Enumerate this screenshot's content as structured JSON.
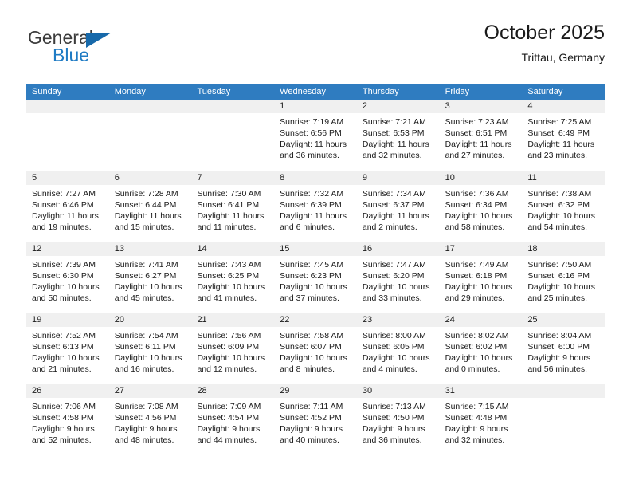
{
  "brand": {
    "name_top": "General",
    "name_bottom": "Blue",
    "accent_color": "#1f7bc4",
    "triangle_color": "#1769aa"
  },
  "header": {
    "title": "October 2025",
    "location": "Trittau, Germany"
  },
  "theme": {
    "header_bg": "#2f7cc0",
    "day_band_bg": "#f0f0f0",
    "cell_bg": "#ffffff",
    "text_color": "#1a1a1a"
  },
  "weekdays": [
    "Sunday",
    "Monday",
    "Tuesday",
    "Wednesday",
    "Thursday",
    "Friday",
    "Saturday"
  ],
  "weeks": [
    [
      {
        "day": "",
        "lines": []
      },
      {
        "day": "",
        "lines": []
      },
      {
        "day": "",
        "lines": []
      },
      {
        "day": "1",
        "lines": [
          "Sunrise: 7:19 AM",
          "Sunset: 6:56 PM",
          "Daylight: 11 hours",
          "and 36 minutes."
        ]
      },
      {
        "day": "2",
        "lines": [
          "Sunrise: 7:21 AM",
          "Sunset: 6:53 PM",
          "Daylight: 11 hours",
          "and 32 minutes."
        ]
      },
      {
        "day": "3",
        "lines": [
          "Sunrise: 7:23 AM",
          "Sunset: 6:51 PM",
          "Daylight: 11 hours",
          "and 27 minutes."
        ]
      },
      {
        "day": "4",
        "lines": [
          "Sunrise: 7:25 AM",
          "Sunset: 6:49 PM",
          "Daylight: 11 hours",
          "and 23 minutes."
        ]
      }
    ],
    [
      {
        "day": "5",
        "lines": [
          "Sunrise: 7:27 AM",
          "Sunset: 6:46 PM",
          "Daylight: 11 hours",
          "and 19 minutes."
        ]
      },
      {
        "day": "6",
        "lines": [
          "Sunrise: 7:28 AM",
          "Sunset: 6:44 PM",
          "Daylight: 11 hours",
          "and 15 minutes."
        ]
      },
      {
        "day": "7",
        "lines": [
          "Sunrise: 7:30 AM",
          "Sunset: 6:41 PM",
          "Daylight: 11 hours",
          "and 11 minutes."
        ]
      },
      {
        "day": "8",
        "lines": [
          "Sunrise: 7:32 AM",
          "Sunset: 6:39 PM",
          "Daylight: 11 hours",
          "and 6 minutes."
        ]
      },
      {
        "day": "9",
        "lines": [
          "Sunrise: 7:34 AM",
          "Sunset: 6:37 PM",
          "Daylight: 11 hours",
          "and 2 minutes."
        ]
      },
      {
        "day": "10",
        "lines": [
          "Sunrise: 7:36 AM",
          "Sunset: 6:34 PM",
          "Daylight: 10 hours",
          "and 58 minutes."
        ]
      },
      {
        "day": "11",
        "lines": [
          "Sunrise: 7:38 AM",
          "Sunset: 6:32 PM",
          "Daylight: 10 hours",
          "and 54 minutes."
        ]
      }
    ],
    [
      {
        "day": "12",
        "lines": [
          "Sunrise: 7:39 AM",
          "Sunset: 6:30 PM",
          "Daylight: 10 hours",
          "and 50 minutes."
        ]
      },
      {
        "day": "13",
        "lines": [
          "Sunrise: 7:41 AM",
          "Sunset: 6:27 PM",
          "Daylight: 10 hours",
          "and 45 minutes."
        ]
      },
      {
        "day": "14",
        "lines": [
          "Sunrise: 7:43 AM",
          "Sunset: 6:25 PM",
          "Daylight: 10 hours",
          "and 41 minutes."
        ]
      },
      {
        "day": "15",
        "lines": [
          "Sunrise: 7:45 AM",
          "Sunset: 6:23 PM",
          "Daylight: 10 hours",
          "and 37 minutes."
        ]
      },
      {
        "day": "16",
        "lines": [
          "Sunrise: 7:47 AM",
          "Sunset: 6:20 PM",
          "Daylight: 10 hours",
          "and 33 minutes."
        ]
      },
      {
        "day": "17",
        "lines": [
          "Sunrise: 7:49 AM",
          "Sunset: 6:18 PM",
          "Daylight: 10 hours",
          "and 29 minutes."
        ]
      },
      {
        "day": "18",
        "lines": [
          "Sunrise: 7:50 AM",
          "Sunset: 6:16 PM",
          "Daylight: 10 hours",
          "and 25 minutes."
        ]
      }
    ],
    [
      {
        "day": "19",
        "lines": [
          "Sunrise: 7:52 AM",
          "Sunset: 6:13 PM",
          "Daylight: 10 hours",
          "and 21 minutes."
        ]
      },
      {
        "day": "20",
        "lines": [
          "Sunrise: 7:54 AM",
          "Sunset: 6:11 PM",
          "Daylight: 10 hours",
          "and 16 minutes."
        ]
      },
      {
        "day": "21",
        "lines": [
          "Sunrise: 7:56 AM",
          "Sunset: 6:09 PM",
          "Daylight: 10 hours",
          "and 12 minutes."
        ]
      },
      {
        "day": "22",
        "lines": [
          "Sunrise: 7:58 AM",
          "Sunset: 6:07 PM",
          "Daylight: 10 hours",
          "and 8 minutes."
        ]
      },
      {
        "day": "23",
        "lines": [
          "Sunrise: 8:00 AM",
          "Sunset: 6:05 PM",
          "Daylight: 10 hours",
          "and 4 minutes."
        ]
      },
      {
        "day": "24",
        "lines": [
          "Sunrise: 8:02 AM",
          "Sunset: 6:02 PM",
          "Daylight: 10 hours",
          "and 0 minutes."
        ]
      },
      {
        "day": "25",
        "lines": [
          "Sunrise: 8:04 AM",
          "Sunset: 6:00 PM",
          "Daylight: 9 hours",
          "and 56 minutes."
        ]
      }
    ],
    [
      {
        "day": "26",
        "lines": [
          "Sunrise: 7:06 AM",
          "Sunset: 4:58 PM",
          "Daylight: 9 hours",
          "and 52 minutes."
        ]
      },
      {
        "day": "27",
        "lines": [
          "Sunrise: 7:08 AM",
          "Sunset: 4:56 PM",
          "Daylight: 9 hours",
          "and 48 minutes."
        ]
      },
      {
        "day": "28",
        "lines": [
          "Sunrise: 7:09 AM",
          "Sunset: 4:54 PM",
          "Daylight: 9 hours",
          "and 44 minutes."
        ]
      },
      {
        "day": "29",
        "lines": [
          "Sunrise: 7:11 AM",
          "Sunset: 4:52 PM",
          "Daylight: 9 hours",
          "and 40 minutes."
        ]
      },
      {
        "day": "30",
        "lines": [
          "Sunrise: 7:13 AM",
          "Sunset: 4:50 PM",
          "Daylight: 9 hours",
          "and 36 minutes."
        ]
      },
      {
        "day": "31",
        "lines": [
          "Sunrise: 7:15 AM",
          "Sunset: 4:48 PM",
          "Daylight: 9 hours",
          "and 32 minutes."
        ]
      },
      {
        "day": "",
        "lines": []
      }
    ]
  ]
}
